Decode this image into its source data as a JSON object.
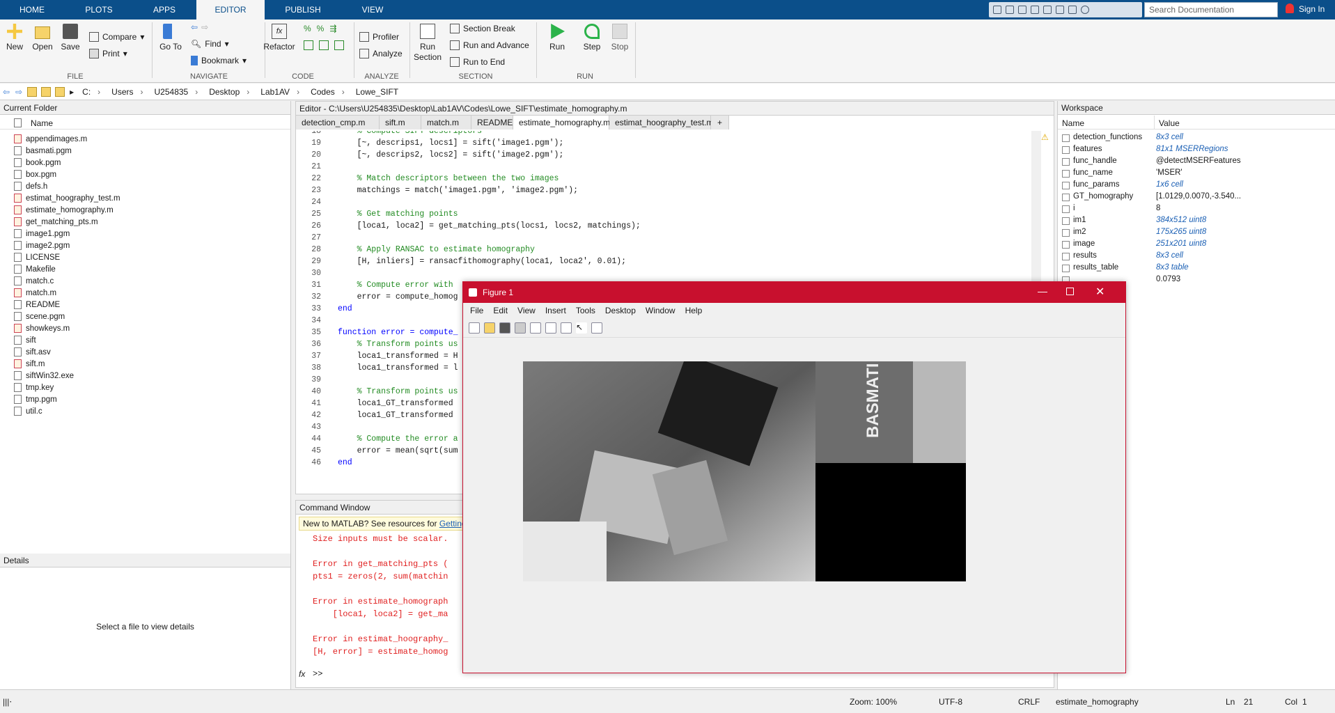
{
  "toolstrip": {
    "tabs": [
      "HOME",
      "PLOTS",
      "APPS",
      "EDITOR",
      "PUBLISH",
      "VIEW"
    ],
    "active_tab": "EDITOR",
    "search_placeholder": "Search Documentation",
    "sign_in": "Sign In"
  },
  "ribbon": {
    "file": {
      "new": "New",
      "open": "Open",
      "save": "Save",
      "compare": "Compare",
      "print": "Print",
      "group": "FILE"
    },
    "navigate": {
      "goto": "Go To",
      "find": "Find",
      "bookmark": "Bookmark",
      "group": "NAVIGATE"
    },
    "code": {
      "refactor": "Refactor",
      "group": "CODE"
    },
    "analyze": {
      "profiler": "Profiler",
      "analyze": "Analyze",
      "group": "ANALYZE"
    },
    "section": {
      "run_section": "Run Section",
      "section_break": "Section Break",
      "run_advance": "Run and Advance",
      "run_end": "Run to End",
      "group": "SECTION"
    },
    "run": {
      "run": "Run",
      "step": "Step",
      "stop": "Stop",
      "group": "RUN"
    }
  },
  "address": [
    "C:",
    "Users",
    "U254835",
    "Desktop",
    "Lab1AV",
    "Codes",
    "Lowe_SIFT"
  ],
  "current_folder": {
    "title": "Current Folder",
    "col": "Name",
    "files": [
      {
        "name": "appendimages.m",
        "kind": "m"
      },
      {
        "name": "basmati.pgm",
        "kind": "f"
      },
      {
        "name": "book.pgm",
        "kind": "f"
      },
      {
        "name": "box.pgm",
        "kind": "f"
      },
      {
        "name": "defs.h",
        "kind": "f"
      },
      {
        "name": "estimat_hoography_test.m",
        "kind": "m"
      },
      {
        "name": "estimate_homography.m",
        "kind": "m"
      },
      {
        "name": "get_matching_pts.m",
        "kind": "m"
      },
      {
        "name": "image1.pgm",
        "kind": "f"
      },
      {
        "name": "image2.pgm",
        "kind": "f"
      },
      {
        "name": "LICENSE",
        "kind": "f"
      },
      {
        "name": "Makefile",
        "kind": "f"
      },
      {
        "name": "match.c",
        "kind": "f"
      },
      {
        "name": "match.m",
        "kind": "m"
      },
      {
        "name": "README",
        "kind": "f"
      },
      {
        "name": "scene.pgm",
        "kind": "f"
      },
      {
        "name": "showkeys.m",
        "kind": "m"
      },
      {
        "name": "sift",
        "kind": "f"
      },
      {
        "name": "sift.asv",
        "kind": "f"
      },
      {
        "name": "sift.m",
        "kind": "m"
      },
      {
        "name": "siftWin32.exe",
        "kind": "f"
      },
      {
        "name": "tmp.key",
        "kind": "f"
      },
      {
        "name": "tmp.pgm",
        "kind": "f"
      },
      {
        "name": "util.c",
        "kind": "f"
      }
    ]
  },
  "details": {
    "title": "Details",
    "empty": "Select a file to view details"
  },
  "editor": {
    "title": "Editor - C:\\Users\\U254835\\Desktop\\Lab1AV\\Codes\\Lowe_SIFT\\estimate_homography.m",
    "tabs": [
      "detection_cmp.m",
      "sift.m",
      "match.m",
      "README",
      "estimate_homography.m",
      "estimat_hoography_test.m"
    ],
    "active_tab": "estimate_homography.m",
    "lines": [
      {
        "n": "18",
        "t": "    % Compute SIFT descriptors",
        "c": "cm"
      },
      {
        "n": "19",
        "t": "    [~, descrips1, locs1] = sift('image1.pgm');",
        "c": ""
      },
      {
        "n": "20",
        "t": "    [~, descrips2, locs2] = sift('image2.pgm');",
        "c": ""
      },
      {
        "n": "21",
        "t": "",
        "c": ""
      },
      {
        "n": "22",
        "t": "    % Match descriptors between the two images",
        "c": "cm"
      },
      {
        "n": "23",
        "t": "    matchings = match('image1.pgm', 'image2.pgm');",
        "c": ""
      },
      {
        "n": "24",
        "t": "",
        "c": ""
      },
      {
        "n": "25",
        "t": "    % Get matching points",
        "c": "cm"
      },
      {
        "n": "26",
        "t": "    [loca1, loca2] = get_matching_pts(locs1, locs2, matchings);",
        "c": ""
      },
      {
        "n": "27",
        "t": "",
        "c": ""
      },
      {
        "n": "28",
        "t": "    % Apply RANSAC to estimate homography",
        "c": "cm"
      },
      {
        "n": "29",
        "t": "    [H, inliers] = ransacfithomography(loca1, loca2', 0.01);",
        "c": ""
      },
      {
        "n": "30",
        "t": "",
        "c": ""
      },
      {
        "n": "31",
        "t": "    % Compute error with",
        "c": "cm"
      },
      {
        "n": "32",
        "t": "    error = compute_homog",
        "c": ""
      },
      {
        "n": "33",
        "t": "end",
        "c": "kw"
      },
      {
        "n": "34",
        "t": "",
        "c": ""
      },
      {
        "n": "35",
        "t": "function error = compute_",
        "c": "kw"
      },
      {
        "n": "36",
        "t": "    % Transform points us",
        "c": "cm"
      },
      {
        "n": "37",
        "t": "    loca1_transformed = H",
        "c": ""
      },
      {
        "n": "38",
        "t": "    loca1_transformed = l",
        "c": ""
      },
      {
        "n": "39",
        "t": "",
        "c": ""
      },
      {
        "n": "40",
        "t": "    % Transform points us",
        "c": "cm"
      },
      {
        "n": "41",
        "t": "    loca1_GT_transformed",
        "c": ""
      },
      {
        "n": "42",
        "t": "    loca1_GT_transformed",
        "c": ""
      },
      {
        "n": "43",
        "t": "",
        "c": ""
      },
      {
        "n": "44",
        "t": "    % Compute the error a",
        "c": "cm"
      },
      {
        "n": "45",
        "t": "    error = mean(sqrt(sum",
        "c": ""
      },
      {
        "n": "46",
        "t": "end",
        "c": "kw"
      }
    ]
  },
  "command_window": {
    "title": "Command Window",
    "banner": "New to MATLAB? See resources for",
    "banner_link": "Getting S",
    "lines": [
      "Size inputs must be scalar.",
      "",
      "Error in get_matching_pts (",
      "pts1 = zeros(2, sum(matchin",
      "",
      "Error in estimate_homograph",
      "    [loca1, loca2] = get_ma",
      "",
      "Error in estimat_hoography_",
      "[H, error] = estimate_homog"
    ],
    "prompt": ">>"
  },
  "workspace": {
    "title": "Workspace",
    "col_name": "Name",
    "col_value": "Value",
    "vars": [
      {
        "name": "detection_functions",
        "value": "8x3 cell",
        "it": true
      },
      {
        "name": "features",
        "value": "81x1 MSERRegions",
        "it": true
      },
      {
        "name": "func_handle",
        "value": "@detectMSERFeatures",
        "it": false
      },
      {
        "name": "func_name",
        "value": "'MSER'",
        "it": false
      },
      {
        "name": "func_params",
        "value": "1x6 cell",
        "it": true
      },
      {
        "name": "GT_homography",
        "value": "[1.0129,0.0070,-3.540...",
        "it": false
      },
      {
        "name": "i",
        "value": "8",
        "it": false
      },
      {
        "name": "im1",
        "value": "384x512 uint8",
        "it": true
      },
      {
        "name": "im2",
        "value": "175x265 uint8",
        "it": true
      },
      {
        "name": "image",
        "value": "251x201 uint8",
        "it": true
      },
      {
        "name": "results",
        "value": "8x3 cell",
        "it": true
      },
      {
        "name": "results_table",
        "value": "8x3 table",
        "it": true
      },
      {
        "name": "",
        "value": "0.0793",
        "it": false
      }
    ]
  },
  "figure": {
    "title": "Figure 1",
    "menu": [
      "File",
      "Edit",
      "View",
      "Insert",
      "Tools",
      "Desktop",
      "Window",
      "Help"
    ],
    "image_text": "BASMATI"
  },
  "statusbar": {
    "zoom": "Zoom: 100%",
    "encoding": "UTF-8",
    "eol": "CRLF",
    "function": "estimate_homography",
    "ln_label": "Ln",
    "ln": "21",
    "col_label": "Col",
    "col": "1"
  },
  "colors": {
    "toolstrip": "#0b4f8a",
    "figure_title": "#c8102e",
    "match_lines": "#22d3e0"
  }
}
